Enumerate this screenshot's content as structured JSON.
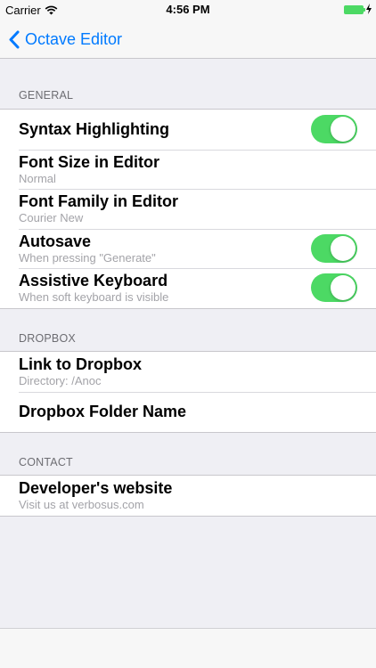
{
  "status_bar": {
    "carrier": "Carrier",
    "time": "4:56 PM"
  },
  "nav": {
    "back_label": "Octave Editor"
  },
  "sections": {
    "general": {
      "header": "GENERAL",
      "rows": [
        {
          "title": "Syntax Highlighting",
          "toggle_on": true
        },
        {
          "title": "Font Size in Editor",
          "subtitle": "Normal"
        },
        {
          "title": "Font Family in Editor",
          "subtitle": "Courier New"
        },
        {
          "title": "Autosave",
          "subtitle": "When pressing \"Generate\"",
          "toggle_on": true
        },
        {
          "title": "Assistive Keyboard",
          "subtitle": "When soft keyboard is visible",
          "toggle_on": true
        }
      ]
    },
    "dropbox": {
      "header": "DROPBOX",
      "rows": [
        {
          "title": "Link to Dropbox",
          "subtitle": "Directory: /Anoc"
        },
        {
          "title": "Dropbox Folder Name"
        }
      ]
    },
    "contact": {
      "header": "CONTACT",
      "rows": [
        {
          "title": "Developer's website",
          "subtitle": "Visit us at verbosus.com"
        }
      ]
    }
  },
  "colors": {
    "accent": "#007aff",
    "toggle_on": "#4cd964",
    "background": "#efeff4"
  }
}
